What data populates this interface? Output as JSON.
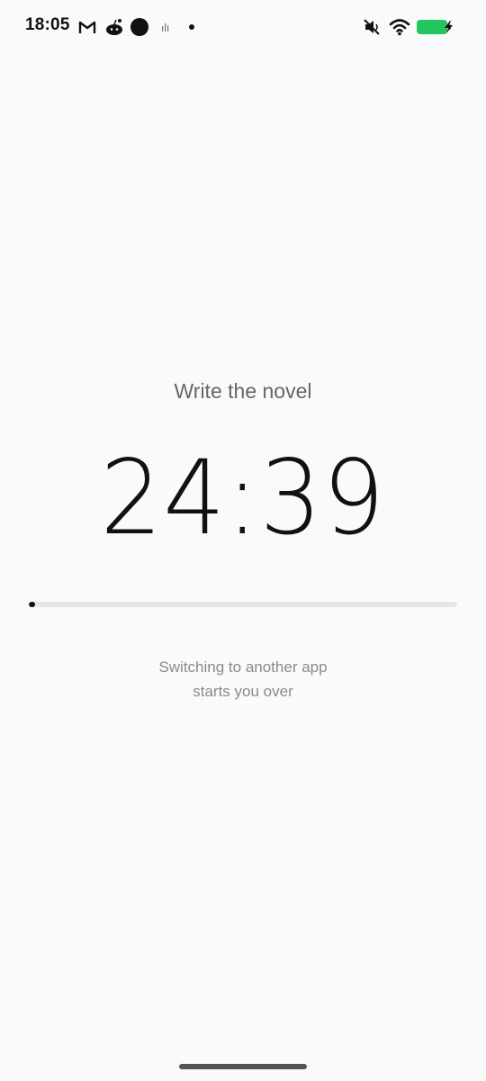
{
  "status_bar": {
    "time": "18:05",
    "left_icons": [
      "gmail-icon",
      "reddit-icon",
      "circle-app-icon",
      "signal-small-icon",
      "notification-dot-icon"
    ],
    "right_icons": [
      "mute-icon",
      "wifi-icon",
      "battery-charging-icon"
    ],
    "battery_color": "#22c55e"
  },
  "focus": {
    "task_title": "Write the novel",
    "timer": "24:39",
    "progress_fraction": 0.014,
    "warning_line1": "Switching to another app",
    "warning_line2": "starts you over"
  },
  "colors": {
    "background": "#fafafa",
    "progress_track": "#e6e6e6",
    "progress_fill": "#111111",
    "muted_text": "#8a8a8a"
  }
}
